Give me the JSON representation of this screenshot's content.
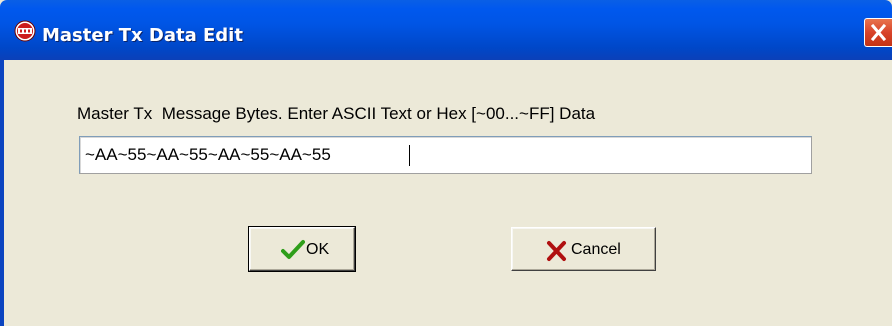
{
  "window": {
    "title": "Master Tx Data Edit",
    "title_bar_color": "#0055e5",
    "close_button_color": "#d8432a",
    "icon": "app-logo-icon"
  },
  "form": {
    "prompt": "Master Tx  Message Bytes. Enter ASCII Text or Hex [~00...~FF] Data",
    "input_value": "~AA~55~AA~55~AA~55~AA~55"
  },
  "buttons": {
    "ok": {
      "label": "OK",
      "icon": "checkmark-icon",
      "icon_color": "#2e9e1a"
    },
    "cancel": {
      "label": "Cancel",
      "icon": "x-cross-icon",
      "icon_color": "#b01010"
    }
  }
}
